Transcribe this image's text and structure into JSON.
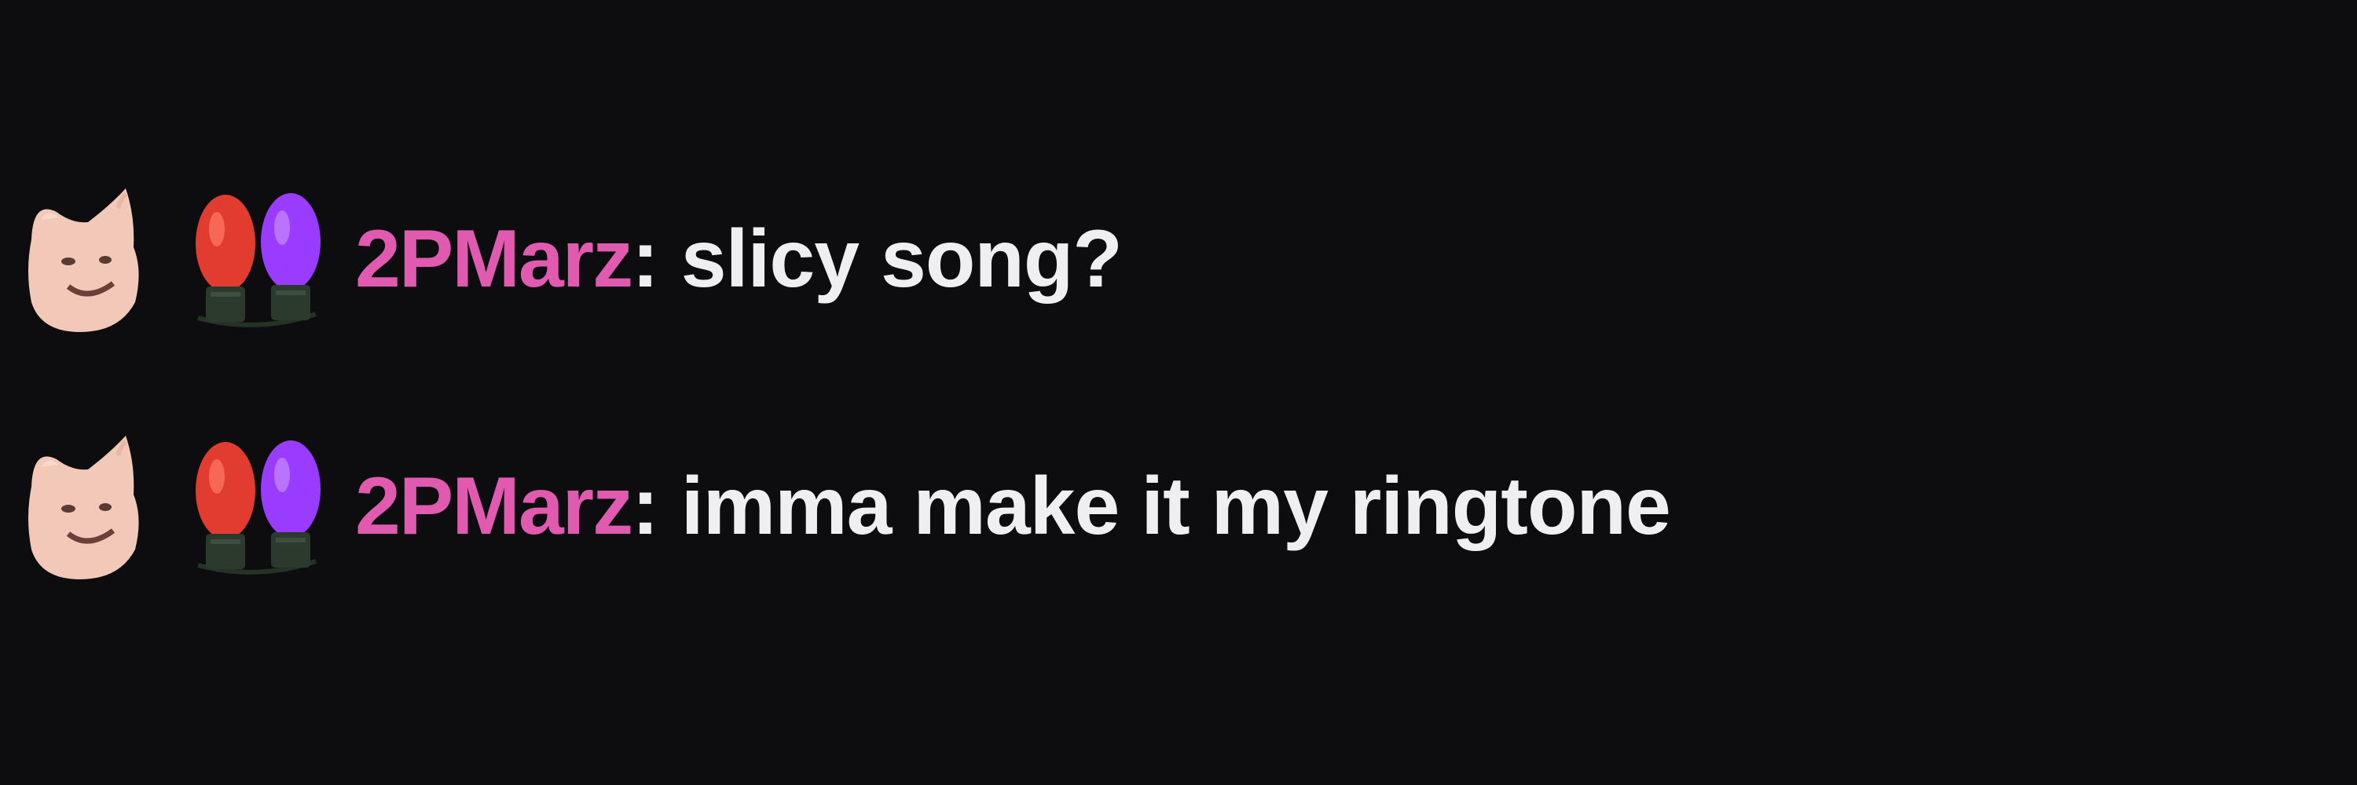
{
  "colors": {
    "background": "#0d0d0f",
    "username": "#e05bb0",
    "message_text": "#efeff1"
  },
  "messages": [
    {
      "badges": [
        "cat-emote-badge",
        "christmas-lights-badge"
      ],
      "username": "2PMarz",
      "separator": ":",
      "text": "slicy song?"
    },
    {
      "badges": [
        "cat-emote-badge",
        "christmas-lights-badge"
      ],
      "username": "2PMarz",
      "separator": ":",
      "text": "imma make it my ringtone"
    }
  ]
}
